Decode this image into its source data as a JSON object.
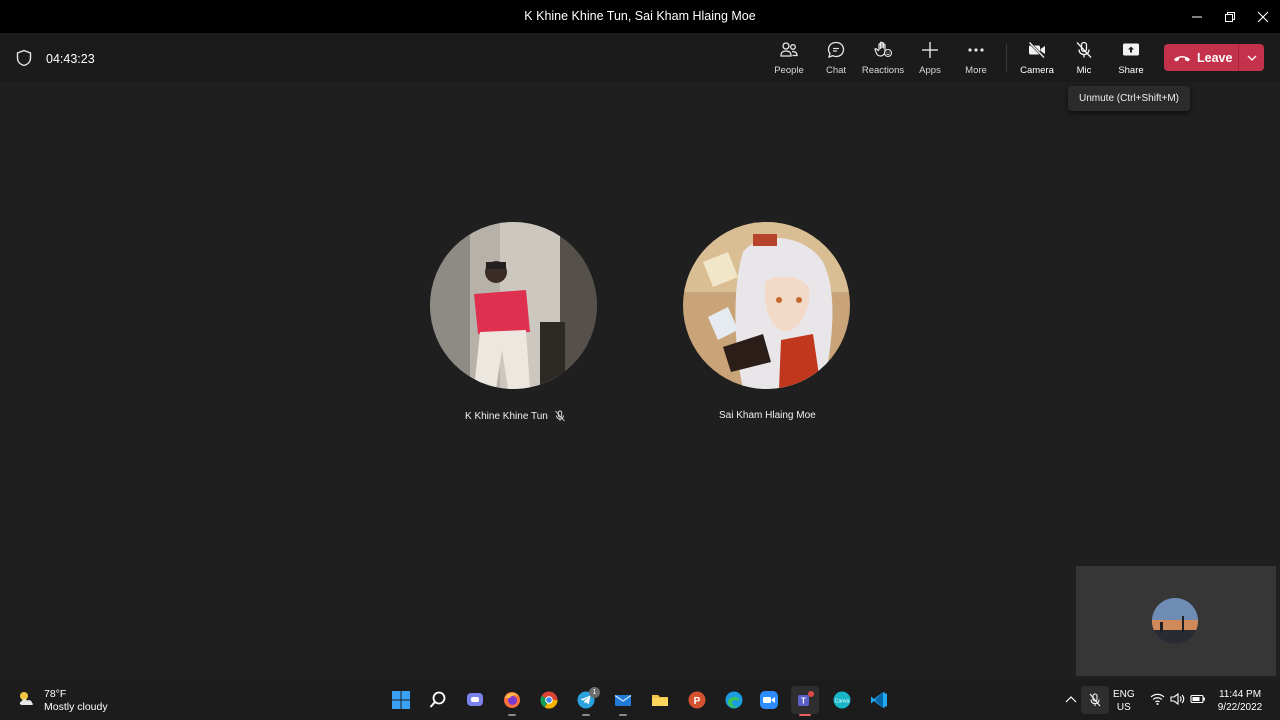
{
  "window": {
    "title": "K Khine Khine Tun, Sai Kham Hlaing Moe"
  },
  "meeting": {
    "timer": "04:43:23",
    "toolbar": {
      "people": "People",
      "chat": "Chat",
      "reactions": "Reactions",
      "apps": "Apps",
      "more": "More",
      "camera": "Camera",
      "mic": "Mic",
      "share": "Share",
      "leave": "Leave"
    },
    "tooltip": "Unmute (Ctrl+Shift+M)",
    "participants": [
      {
        "name": "K Khine Khine Tun",
        "muted": true
      },
      {
        "name": "Sai Kham Hlaing Moe",
        "muted": false
      }
    ],
    "colors": {
      "leave": "#c4314b",
      "background": "#1f1f1f",
      "toolbar": "#1b1b1b"
    }
  },
  "taskbar": {
    "weather": {
      "temp": "78°F",
      "condition": "Mostly cloudy"
    },
    "apps": [
      "windows-start",
      "search",
      "teams-chat",
      "firefox",
      "chrome",
      "telegram",
      "mail",
      "file-explorer",
      "powerpoint",
      "edge",
      "zoom",
      "teams",
      "canva",
      "vscode"
    ],
    "telegram_badge": "1",
    "language": {
      "line1": "ENG",
      "line2": "US"
    },
    "clock": {
      "time": "11:44 PM",
      "date": "9/22/2022"
    }
  }
}
